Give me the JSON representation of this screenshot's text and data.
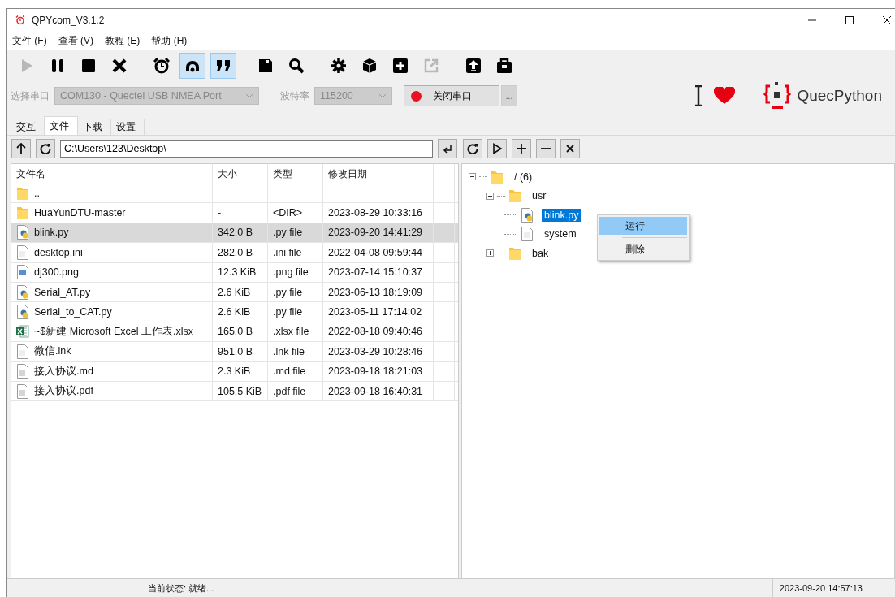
{
  "window": {
    "title": "QPYcom_V3.1.2"
  },
  "menu": [
    "文件 (F)",
    "查看 (V)",
    "教程 (E)",
    "帮助 (H)"
  ],
  "toolbar": [
    {
      "kind": "play",
      "disabled": true,
      "selected": false
    },
    {
      "kind": "pause",
      "disabled": false,
      "selected": false
    },
    {
      "kind": "stop",
      "disabled": false,
      "selected": false
    },
    {
      "kind": "close",
      "disabled": false,
      "selected": false
    },
    {
      "kind": "alarm",
      "disabled": false,
      "selected": false
    },
    {
      "kind": "loop",
      "disabled": false,
      "selected": true
    },
    {
      "kind": "quote",
      "disabled": false,
      "selected": true
    },
    {
      "kind": "save",
      "disabled": false,
      "selected": false
    },
    {
      "kind": "search",
      "disabled": false,
      "selected": false
    },
    {
      "kind": "gear",
      "disabled": false,
      "selected": false
    },
    {
      "kind": "cube",
      "disabled": false,
      "selected": false
    },
    {
      "kind": "plus",
      "disabled": false,
      "selected": false
    },
    {
      "kind": "export",
      "disabled": true,
      "selected": false
    },
    {
      "kind": "upload",
      "disabled": false,
      "selected": false
    },
    {
      "kind": "toolbox",
      "disabled": false,
      "selected": false
    }
  ],
  "port_row": {
    "port_label": "选择串口",
    "port_value": "COM130 - Quectel USB NMEA Port",
    "baud_label": "波特率",
    "baud_value": "115200",
    "connect_button": "关闭串口",
    "connected": true,
    "more_button": "..."
  },
  "brand": {
    "name": "QuecPython"
  },
  "tabs": [
    {
      "label": "交互",
      "selected": false
    },
    {
      "label": "文件",
      "selected": true
    },
    {
      "label": "下载",
      "selected": false
    },
    {
      "label": "设置",
      "selected": false
    }
  ],
  "local": {
    "path": "C:\\Users\\123\\Desktop\\",
    "columns": [
      "文件名",
      "大小",
      "类型",
      "修改日期"
    ],
    "rows": [
      {
        "kind": "folder",
        "name": "..",
        "size": "",
        "type": "",
        "modified": "",
        "selected": false
      },
      {
        "kind": "folder",
        "name": "HuaYunDTU-master",
        "size": "-",
        "type": "<DIR>",
        "modified": "2023-08-29 10:33:16",
        "selected": false
      },
      {
        "kind": "python",
        "name": "blink.py",
        "size": "342.0 B",
        "type": ".py file",
        "modified": "2023-09-20 14:41:29",
        "selected": true
      },
      {
        "kind": "file",
        "name": "desktop.ini",
        "size": "282.0 B",
        "type": ".ini file",
        "modified": "2022-04-08 09:59:44",
        "selected": false
      },
      {
        "kind": "image",
        "name": "dj300.png",
        "size": "12.3 KiB",
        "type": ".png file",
        "modified": "2023-07-14 15:10:37",
        "selected": false
      },
      {
        "kind": "python",
        "name": "Serial_AT.py",
        "size": "2.6 KiB",
        "type": ".py file",
        "modified": "2023-06-13 18:19:09",
        "selected": false
      },
      {
        "kind": "python",
        "name": "Serial_to_CAT.py",
        "size": "2.6 KiB",
        "type": ".py file",
        "modified": "2023-05-11 17:14:02",
        "selected": false
      },
      {
        "kind": "excel",
        "name": "~$新建 Microsoft Excel 工作表.xlsx",
        "size": "165.0 B",
        "type": ".xlsx file",
        "modified": "2022-08-18 09:40:46",
        "selected": false
      },
      {
        "kind": "file",
        "name": "微信.lnk",
        "size": "951.0 B",
        "type": ".lnk file",
        "modified": "2023-03-29 10:28:46",
        "selected": false
      },
      {
        "kind": "text",
        "name": "接入协议.md",
        "size": "2.3 KiB",
        "type": ".md file",
        "modified": "2023-09-18 18:21:03",
        "selected": false
      },
      {
        "kind": "text",
        "name": "接入协议.pdf",
        "size": "105.5 KiB",
        "type": ".pdf file",
        "modified": "2023-09-18 16:40:31",
        "selected": false
      }
    ]
  },
  "device": {
    "tree": [
      {
        "kind": "folder",
        "name": "/ (6)",
        "expanded": true,
        "selected": false,
        "children": [
          {
            "kind": "folder",
            "name": "usr",
            "expanded": true,
            "selected": false,
            "children": [
              {
                "kind": "python",
                "name": "blink.py",
                "selected": true
              },
              {
                "kind": "file",
                "name": "system",
                "selected": false
              }
            ]
          },
          {
            "kind": "folder",
            "name": "bak",
            "expanded": false,
            "selected": false
          }
        ]
      }
    ],
    "context_menu": [
      {
        "label": "运行",
        "selected": true
      },
      {
        "label": "删除",
        "selected": false
      }
    ]
  },
  "status_bar": {
    "state": "当前状态: 就绪...",
    "time": "2023-09-20 14:57:13"
  }
}
